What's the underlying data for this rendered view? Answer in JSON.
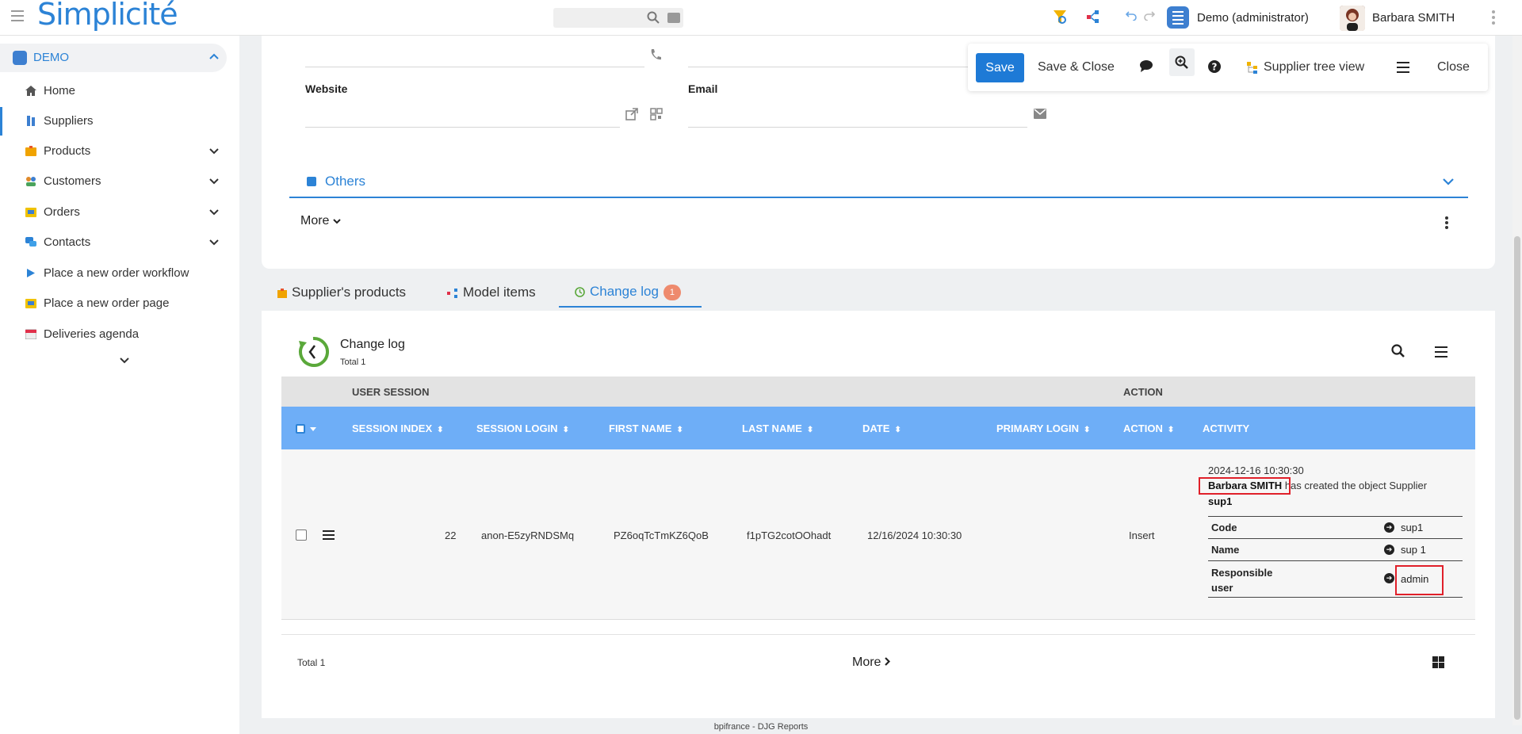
{
  "app": {
    "logo": "Simplicité",
    "footer": "bpifrance - DJG Reports"
  },
  "topbar": {
    "scope": "Demo (administrator)",
    "user": "Barbara SMITH"
  },
  "sidebar": {
    "section": "DEMO",
    "items": [
      {
        "label": "Home"
      },
      {
        "label": "Suppliers"
      },
      {
        "label": "Products"
      },
      {
        "label": "Customers"
      },
      {
        "label": "Orders"
      },
      {
        "label": "Contacts"
      },
      {
        "label": "Place a new order workflow"
      },
      {
        "label": "Place a new order page"
      },
      {
        "label": "Deliveries agenda"
      }
    ]
  },
  "form": {
    "website_label": "Website",
    "email_label": "Email",
    "others_label": "Others",
    "more_label": "More"
  },
  "actions": {
    "save": "Save",
    "save_close": "Save & Close",
    "tree_view": "Supplier tree view",
    "close": "Close"
  },
  "tabs": [
    {
      "label": "Supplier's products"
    },
    {
      "label": "Model items"
    },
    {
      "label": "Change log",
      "count": "1"
    }
  ],
  "changelog": {
    "title": "Change log",
    "total": "Total 1",
    "groups": {
      "user_session": "USER SESSION",
      "action": "ACTION"
    },
    "columns": [
      "SESSION INDEX",
      "SESSION LOGIN",
      "FIRST NAME",
      "LAST NAME",
      "DATE",
      "PRIMARY LOGIN",
      "ACTION",
      "ACTIVITY"
    ],
    "row": {
      "session_index": "22",
      "session_login": "anon-E5zyRNDSMq",
      "first_name": "PZ6oqTcTmKZ6QoB",
      "last_name": "f1pTG2cotOOhadt",
      "date": "12/16/2024 10:30:30",
      "primary_login": "",
      "action": "Insert",
      "activity": {
        "timestamp": "2024-12-16 10:30:30",
        "user": "Barbara SMITH",
        "text": " has created the object Supplier",
        "object": "sup1",
        "fields": [
          {
            "key": "Code",
            "value": "sup1"
          },
          {
            "key": "Name",
            "value": "sup 1"
          },
          {
            "key": "Responsible user",
            "value": "admin"
          }
        ]
      }
    },
    "footer_total": "Total 1",
    "footer_more": "More"
  },
  "colors": {
    "accent": "#2c83d6",
    "header": "#6eaef7",
    "badge": "#ee8a6d",
    "highlight": "#e0202a"
  }
}
